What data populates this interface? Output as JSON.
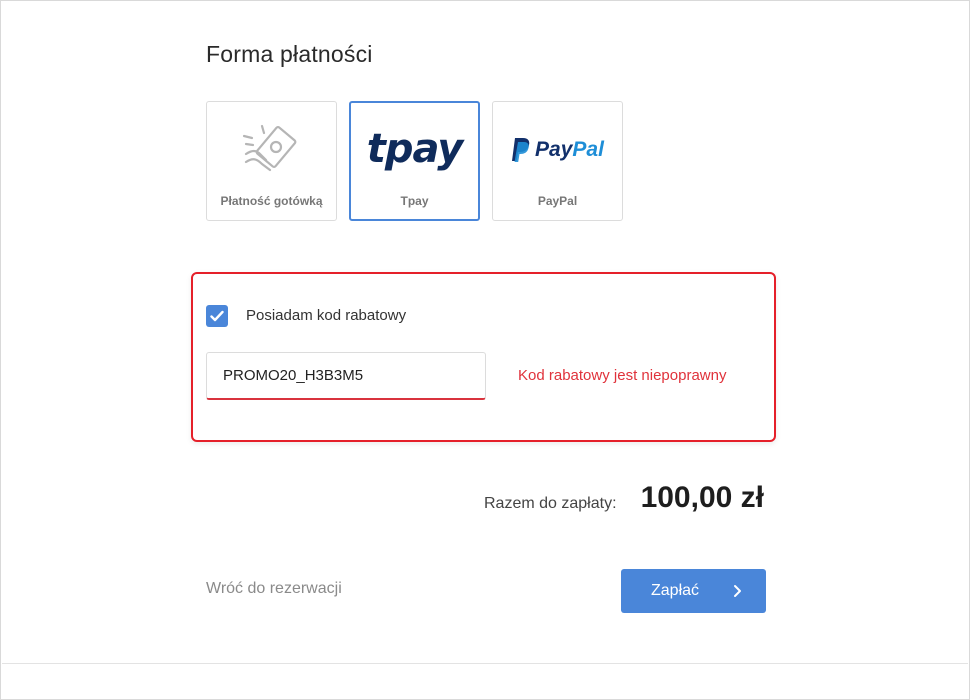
{
  "page": {
    "title": "Forma płatności"
  },
  "methods": [
    {
      "id": "cash",
      "label": "Płatność gotówką",
      "icon": "cash-hand-icon",
      "selected": false
    },
    {
      "id": "tpay",
      "label": "Tpay",
      "logo_text": "tpay",
      "selected": true
    },
    {
      "id": "paypal",
      "label": "PayPal",
      "logo_pay": "Pay",
      "logo_pal": "Pal",
      "icon": "paypal-p-icon",
      "selected": false
    }
  ],
  "promo": {
    "checkbox_label": "Posiadam kod rabatowy",
    "checked": true,
    "code_value": "PROMO20_H3B3M5",
    "error": "Kod rabatowy jest niepoprawny"
  },
  "summary": {
    "total_label": "Razem do zapłaty:",
    "total_amount": "100,00 zł"
  },
  "actions": {
    "back_label": "Wróć do rezerwacji",
    "pay_label": "Zapłać"
  },
  "colors": {
    "accent": "#4a86d9",
    "error": "#e5202a",
    "tpay_navy": "#0f2b5b",
    "paypal_dark": "#12306b",
    "paypal_light": "#1e8ed7"
  }
}
